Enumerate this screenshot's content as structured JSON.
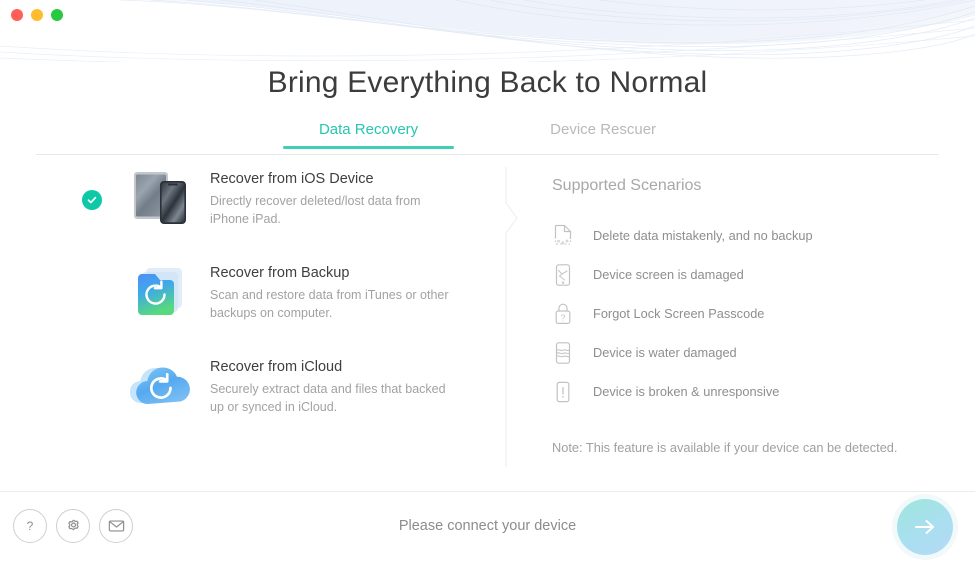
{
  "window": {
    "traffic_lights": [
      {
        "name": "close",
        "color": "#ff5f57"
      },
      {
        "name": "minimize",
        "color": "#febc2e"
      },
      {
        "name": "maximize",
        "color": "#28c840"
      }
    ]
  },
  "header": {
    "title": "Bring Everything Back to Normal"
  },
  "tabs": [
    {
      "label": "Data Recovery",
      "active": true
    },
    {
      "label": "Device Rescuer",
      "active": false
    }
  ],
  "options": [
    {
      "title": "Recover from iOS Device",
      "description": "Directly recover deleted/lost data from iPhone iPad.",
      "icon": "ios-device-icon",
      "selected": true
    },
    {
      "title": "Recover from Backup",
      "description": "Scan and restore data from iTunes or other backups on computer.",
      "icon": "backup-folder-icon",
      "selected": false
    },
    {
      "title": "Recover from iCloud",
      "description": "Securely extract data and files that backed up or synced in iCloud.",
      "icon": "icloud-icon",
      "selected": false
    }
  ],
  "scenarios": {
    "title": "Supported Scenarios",
    "items": [
      {
        "label": "Delete data mistakenly, and no backup",
        "icon": "deleted-file-icon"
      },
      {
        "label": "Device screen is damaged",
        "icon": "cracked-screen-icon"
      },
      {
        "label": "Forgot Lock Screen Passcode",
        "icon": "lock-question-icon"
      },
      {
        "label": "Device is water damaged",
        "icon": "water-damage-icon"
      },
      {
        "label": "Device is broken & unresponsive",
        "icon": "broken-device-icon"
      }
    ],
    "note": "Note: This feature is available if your device can be detected."
  },
  "footer": {
    "buttons": [
      {
        "name": "help-button",
        "icon": "question-mark-icon"
      },
      {
        "name": "settings-button",
        "icon": "gear-icon"
      },
      {
        "name": "feedback-button",
        "icon": "envelope-icon"
      }
    ],
    "status": "Please connect your device",
    "next_icon": "arrow-right-icon"
  },
  "colors": {
    "accent_teal": "#26c6b0",
    "check_green": "#0ec9a6",
    "title_text": "#3c3c3c",
    "muted_text": "#a2a2a2"
  }
}
